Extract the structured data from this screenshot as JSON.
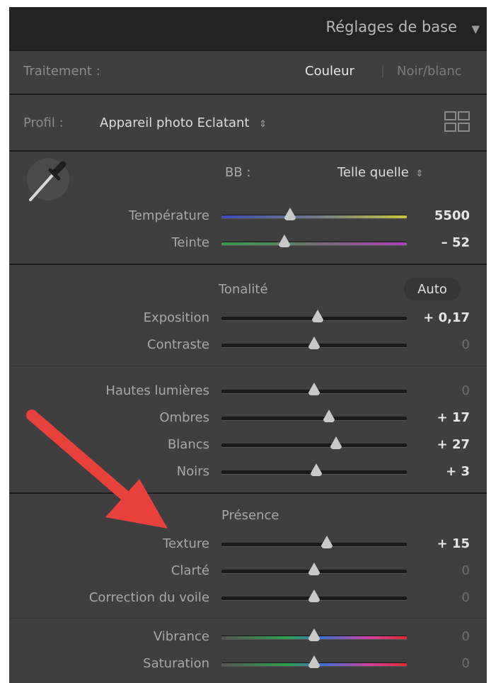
{
  "panel": {
    "title": "Réglages de base",
    "collapse_icon": "triangle-down-icon"
  },
  "treatment": {
    "label": "Traitement :",
    "option_color": "Couleur",
    "option_bw": "Noir/blanc",
    "selected": "Couleur"
  },
  "profile": {
    "label": "Profil :",
    "value": "Appareil photo Eclatant",
    "stepper_icon": "updown-icon",
    "browser_icon": "grid-icon"
  },
  "white_balance": {
    "picker_icon": "eyedropper-icon",
    "label": "BB :",
    "value": "Telle quelle",
    "stepper_icon": "updown-icon"
  },
  "colors": {
    "panel_bg": "#3f3f3f",
    "header_bg": "#232323",
    "active_text": "#e6e6e6",
    "dim_text": "#6c6c6c",
    "arrow": "#e8413c"
  },
  "sliders_wb": [
    {
      "label": "Température",
      "value": "5500",
      "pos": 0.37,
      "gradient": "temp",
      "active": true
    },
    {
      "label": "Teinte",
      "value": "– 52",
      "pos": 0.34,
      "gradient": "tint",
      "active": true
    }
  ],
  "tone": {
    "heading": "Tonalité",
    "auto_label": "Auto",
    "sliders_a": [
      {
        "label": "Exposition",
        "value": "+ 0,17",
        "pos": 0.52,
        "active": true
      },
      {
        "label": "Contraste",
        "value": "0",
        "pos": 0.5,
        "active": false
      }
    ],
    "sliders_b": [
      {
        "label": "Hautes lumières",
        "value": "0",
        "pos": 0.5,
        "active": false
      },
      {
        "label": "Ombres",
        "value": "+ 17",
        "pos": 0.58,
        "active": true
      },
      {
        "label": "Blancs",
        "value": "+ 27",
        "pos": 0.62,
        "active": true
      },
      {
        "label": "Noirs",
        "value": "+ 3",
        "pos": 0.51,
        "active": true
      }
    ]
  },
  "presence": {
    "heading": "Présence",
    "sliders_a": [
      {
        "label": "Texture",
        "value": "+ 15",
        "pos": 0.57,
        "active": true
      },
      {
        "label": "Clarté",
        "value": "0",
        "pos": 0.5,
        "active": false
      },
      {
        "label": "Correction du voile",
        "value": "0",
        "pos": 0.5,
        "active": false
      }
    ],
    "sliders_b": [
      {
        "label": "Vibrance",
        "value": "0",
        "pos": 0.5,
        "gradient": "vib",
        "active": false
      },
      {
        "label": "Saturation",
        "value": "0",
        "pos": 0.5,
        "gradient": "sat",
        "active": false
      }
    ]
  },
  "annotation": {
    "arrow_icon": "red-arrow-icon"
  }
}
